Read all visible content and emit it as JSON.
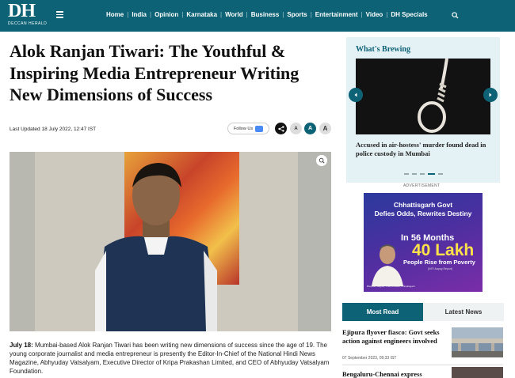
{
  "header": {
    "logo_text": "DH",
    "logo_sub": "DECCAN HERALD",
    "nav": [
      "Home",
      "India",
      "Opinion",
      "Karnataka",
      "World",
      "Business",
      "Sports",
      "Entertainment",
      "Video",
      "DH Specials"
    ],
    "separator": "|",
    "icons": {
      "menu": "hamburger-icon",
      "search": "search-icon"
    },
    "brand_color": "#0d6275"
  },
  "article": {
    "headline": "Alok Ranjan Tiwari: The Youthful & Inspiring Media Entrepreneur Writing New Dimensions of Success",
    "last_updated": "Last Updated 18 July 2022, 12:47 IST",
    "follow_label": "Follow Us",
    "font_buttons": [
      "A",
      "A",
      "A"
    ],
    "body_dateline": "July 18:",
    "body": "Mumbai-based Alok Ranjan Tiwari has been writing new dimensions of success since the age of 19. The young corporate journalist and media entrepreneur is presently the Editor-In-Chief of the National Hindi News Magazine, Abhyuday Vatsalyam, Executive Director of Kripa Prakashan Limited, and CEO of Abhyuday Vatsalyam Foundation."
  },
  "sidebar": {
    "whats_brewing": {
      "title": "What's Brewing",
      "caption": "Accused in air-hostess' murder found dead in police custody in Mumbai",
      "slides": 5,
      "active_slide": 4
    },
    "advertisement": {
      "label": "ADVERTISEMENT",
      "line1": "Chhattisgarh Govt",
      "line2": "Defies Odds, Rewrites Destiny",
      "months": "In 56 Months",
      "big": "40 Lakh",
      "sub": "People Rise from Poverty",
      "source": "(NITI Aayog Report)",
      "person_caption": "Bhupesh Baghel, Chief Minister, Chhattisgarh"
    },
    "tabs": [
      "Most Read",
      "Latest News"
    ],
    "active_tab": 0,
    "news": [
      {
        "title": "Ejipura flyover fiasco: Govt seeks action against engineers involved",
        "date": "07 September 2023, 09:33 IST"
      },
      {
        "title": "Bengaluru-Chennai express"
      }
    ]
  }
}
